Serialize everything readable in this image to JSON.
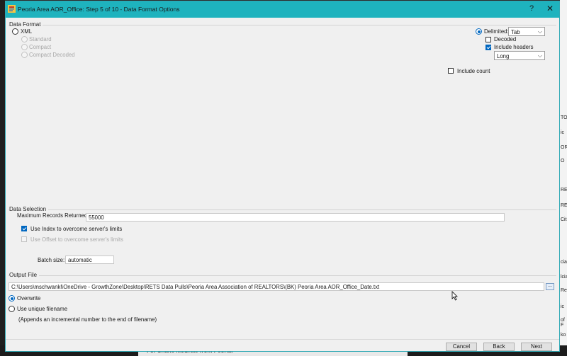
{
  "window": {
    "title": "Peoria Area AOR_Office: Step 5 of 10 - Data Format Options",
    "help": "?",
    "close": "✕"
  },
  "data_format": {
    "group_label": "Data Format",
    "xml_label": "XML",
    "xml_options": [
      "Standard",
      "Compact",
      "Compact Decoded"
    ],
    "delimited_label": "Delimited:",
    "delimiter_value": "Tab",
    "decoded_label": "Decoded",
    "include_headers_label": "Include headers",
    "headers_value": "Long",
    "include_count_label": "Include count"
  },
  "data_selection": {
    "group_label": "Data Selection",
    "max_records_label": "Maximum Records Returned:",
    "max_records_value": "55000",
    "use_index_label": "Use Index to overcome server's limits",
    "use_offset_label": "Use Offset to overcome server's limits",
    "batch_size_label": "Batch size:",
    "batch_size_value": "automatic"
  },
  "output_file": {
    "group_label": "Output File",
    "path": "C:\\Users\\mschwankl\\OneDrive - GrowthZone\\Desktop\\RETS Data Pulls\\Peoria Area Association of REALTORS\\(BK) Peoria Area AOR_Office_Date.txt",
    "browse_label": "...",
    "overwrite_label": "Overwrite",
    "unique_label": "Use unique filename",
    "unique_note": "(Appends an incremental number to the end of filename)"
  },
  "footer": {
    "cancel": "Cancel",
    "back": "Back",
    "next": "Next"
  },
  "background": {
    "right_fragments": [
      "TO",
      "ic",
      "OR",
      "O",
      "RE",
      "RE",
      "Cit",
      "cia",
      "lcia",
      "Re",
      "ic",
      "of F",
      "ko"
    ],
    "bottom_text": "For Shane McGraw from Peoria:"
  },
  "colors": {
    "title_bar": "#1eb3be",
    "accent": "#0067c0",
    "dialog_bg": "#f0f0f0"
  }
}
